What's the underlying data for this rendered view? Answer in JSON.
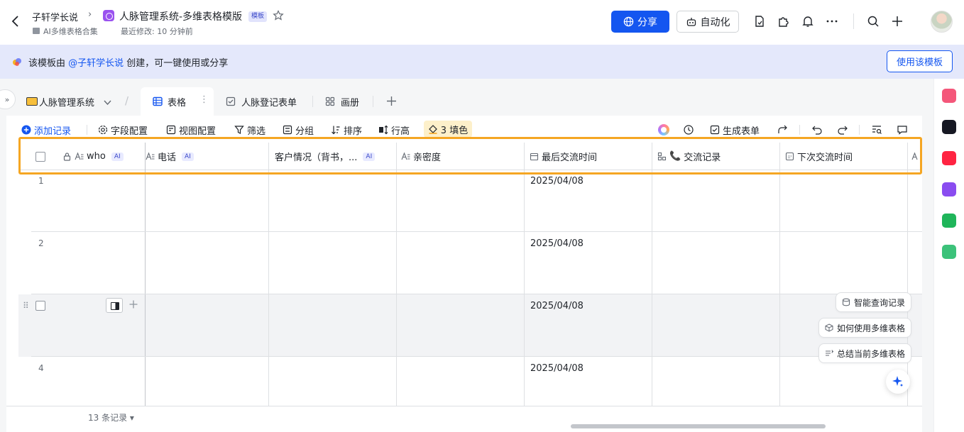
{
  "header": {
    "breadcrumb_parent": "子轩学长说",
    "doc_title": "人脉管理系统-多维表格模版",
    "template_badge": "模板",
    "collection": "AI多维表格合集",
    "last_modified": "最近修改: 10 分钟前",
    "share_label": "分享",
    "automation_label": "自动化"
  },
  "banner": {
    "text_prefix": "该模板由 ",
    "mention": "@子轩学长说",
    "text_suffix": " 创建，可一键使用或分享",
    "use_template_label": "使用该模板"
  },
  "tabs": {
    "base_name": "人脉管理系统",
    "items": [
      {
        "label": "表格",
        "icon": "grid-icon"
      },
      {
        "label": "人脉登记表单",
        "icon": "form-icon"
      },
      {
        "label": "画册",
        "icon": "gallery-icon"
      }
    ]
  },
  "toolbar": {
    "add_record": "添加记录",
    "field_config": "字段配置",
    "view_config": "视图配置",
    "filter": "筛选",
    "group": "分组",
    "sort": "排序",
    "row_height": "行高",
    "fill": "3 填色",
    "generate_form": "生成表单"
  },
  "grid": {
    "columns": [
      {
        "label": "who",
        "ai": "AI"
      },
      {
        "label": "电话",
        "ai": "AI"
      },
      {
        "label": "客户情况（背书，...",
        "ai": "AI"
      },
      {
        "label": "亲密度"
      },
      {
        "label": "最后交流时间"
      },
      {
        "label": "交流记录",
        "emoji": "📞"
      },
      {
        "label": "下次交流时间"
      }
    ],
    "rows": [
      {
        "num": "1",
        "last_contact": "2025/04/08"
      },
      {
        "num": "2",
        "last_contact": "2025/04/08"
      },
      {
        "num": "",
        "last_contact": "2025/04/08"
      },
      {
        "num": "4",
        "last_contact": "2025/04/08"
      }
    ]
  },
  "footer": {
    "record_count": "13 条记录"
  },
  "suggestions": {
    "smart_query": "智能查询记录",
    "how_to_use": "如何使用多维表格",
    "summarize": "总结当前多维表格"
  },
  "colors": {
    "accent": "#1456f0",
    "highlight_border": "#f5a623",
    "banner_bg": "#e4e8fb"
  }
}
